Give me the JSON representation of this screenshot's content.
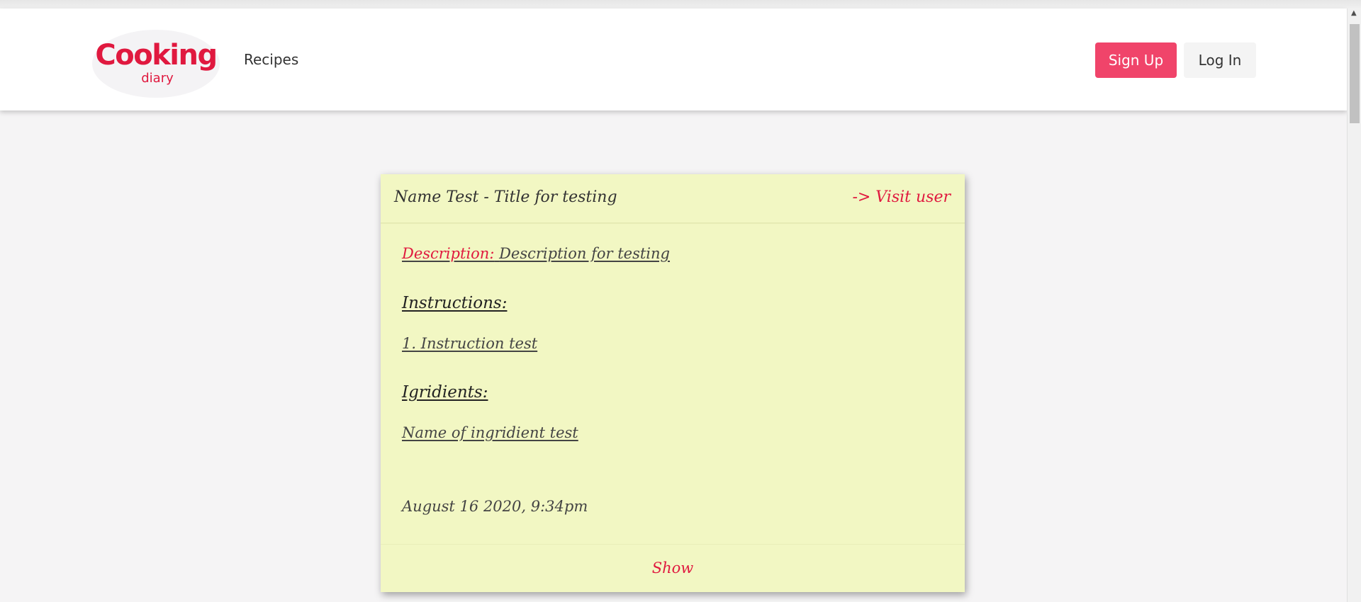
{
  "header": {
    "logo_main": "Cooking",
    "logo_sub": "diary",
    "nav_recipes": "Recipes",
    "signup_label": "Sign Up",
    "login_label": "Log In"
  },
  "recipe": {
    "title": "Name Test - Title for testing",
    "visit_user": "-> Visit user",
    "description_label": "Description:",
    "description": "Description for testing",
    "instructions_heading": "Instructions:",
    "instructions": [
      "1. Instruction test"
    ],
    "ingredients_heading": "Igridients:",
    "ingredients": [
      "Name of ingridient test"
    ],
    "timestamp": "August 16 2020, 9:34pm",
    "show_label": "Show"
  },
  "colors": {
    "brand": "#e0193f",
    "signup_bg": "#f0446a",
    "card_bg": "#f2f7c3",
    "page_bg": "#f5f4f5"
  }
}
